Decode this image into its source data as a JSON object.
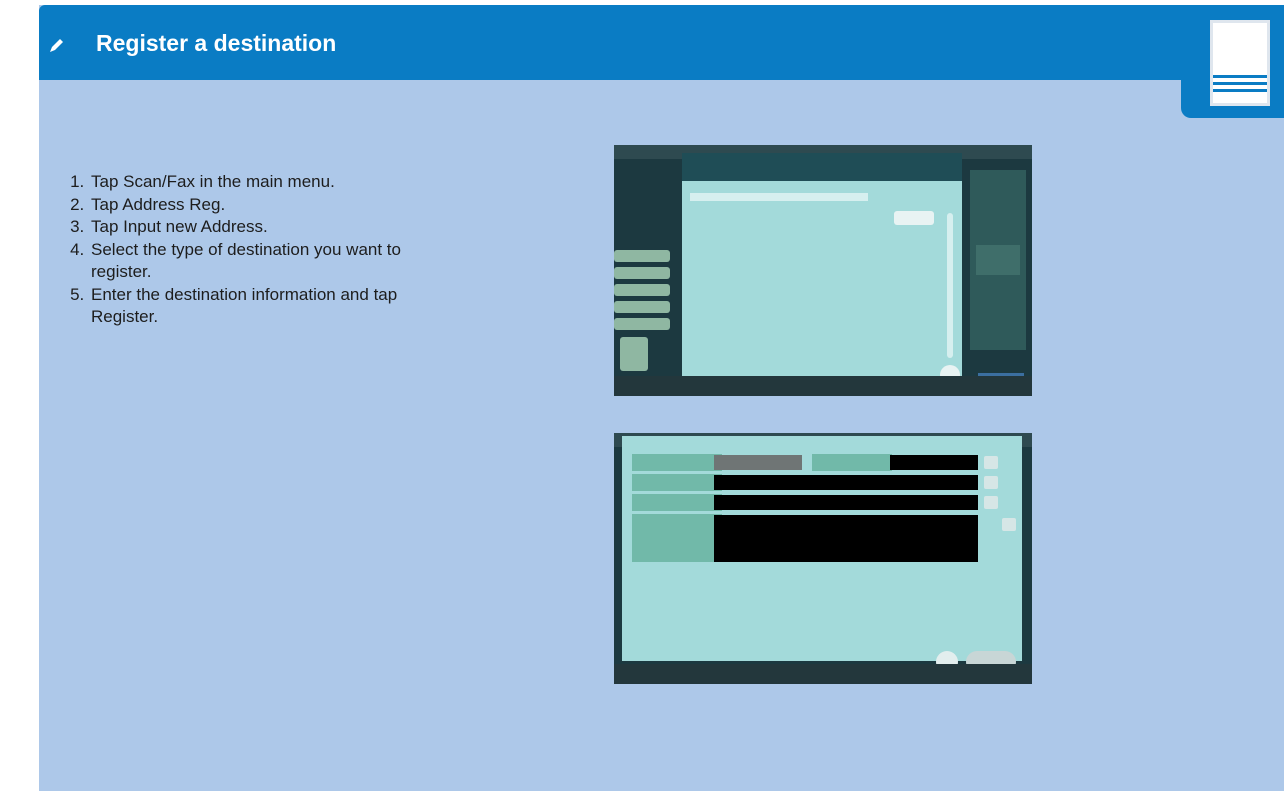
{
  "header": {
    "title": "Register a destination",
    "icon": "pencil-icon",
    "color": "#0a7cc4"
  },
  "tab": {
    "icon": "notebook-icon"
  },
  "steps": [
    "Tap Scan/Fax in the main menu.",
    "Tap Address Reg.",
    "Tap Input new Address.",
    "Select the type of destination you want to register.",
    "Enter the destination information and tap Register."
  ],
  "screenshots": [
    {
      "name": "input-new-address-screen"
    },
    {
      "name": "destination-entry-screen"
    }
  ]
}
